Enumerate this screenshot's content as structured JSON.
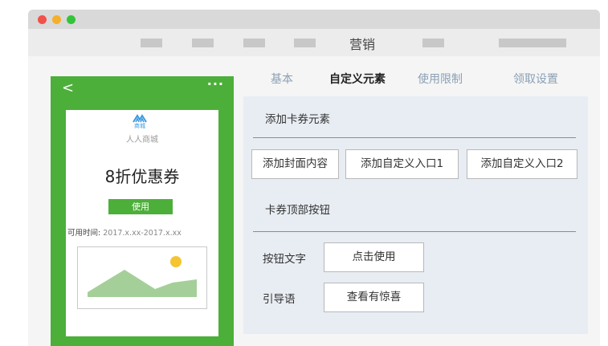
{
  "app": {
    "title": "营销"
  },
  "preview": {
    "back_icon": "back-arrow-icon",
    "back_glyph": "<",
    "more_icon": "more-icon",
    "more_glyph": "···",
    "logo_icon": "shop-logo-icon",
    "logo_text": "商城",
    "shop_name": "人人商城",
    "coupon_title": "8折优惠券",
    "use_button": "使用",
    "time_label": "可用时间:",
    "time_value": "2017.x.xx-2017.x.xx",
    "image_icon": "image-placeholder-icon"
  },
  "tabs": [
    {
      "label": "基本",
      "active": false
    },
    {
      "label": "自定义元素",
      "active": true
    },
    {
      "label": "使用限制",
      "active": false
    },
    {
      "label": "领取设置",
      "active": false
    }
  ],
  "add_elements": {
    "title": "添加卡券元素",
    "buttons": [
      "添加封面内容",
      "添加自定义入口1",
      "添加自定义入口2"
    ]
  },
  "top_button": {
    "title": "卡券顶部按钮",
    "button_text_label": "按钮文字",
    "button_text_value": "点击使用",
    "guide_label": "引导语",
    "guide_value": "查看有惊喜"
  },
  "colors": {
    "brand_green": "#4caf3a",
    "sun": "#f5c431",
    "hill": "#a5cf99",
    "panel_bg": "#e8edf3",
    "tab_inactive": "#8aa0b4"
  }
}
